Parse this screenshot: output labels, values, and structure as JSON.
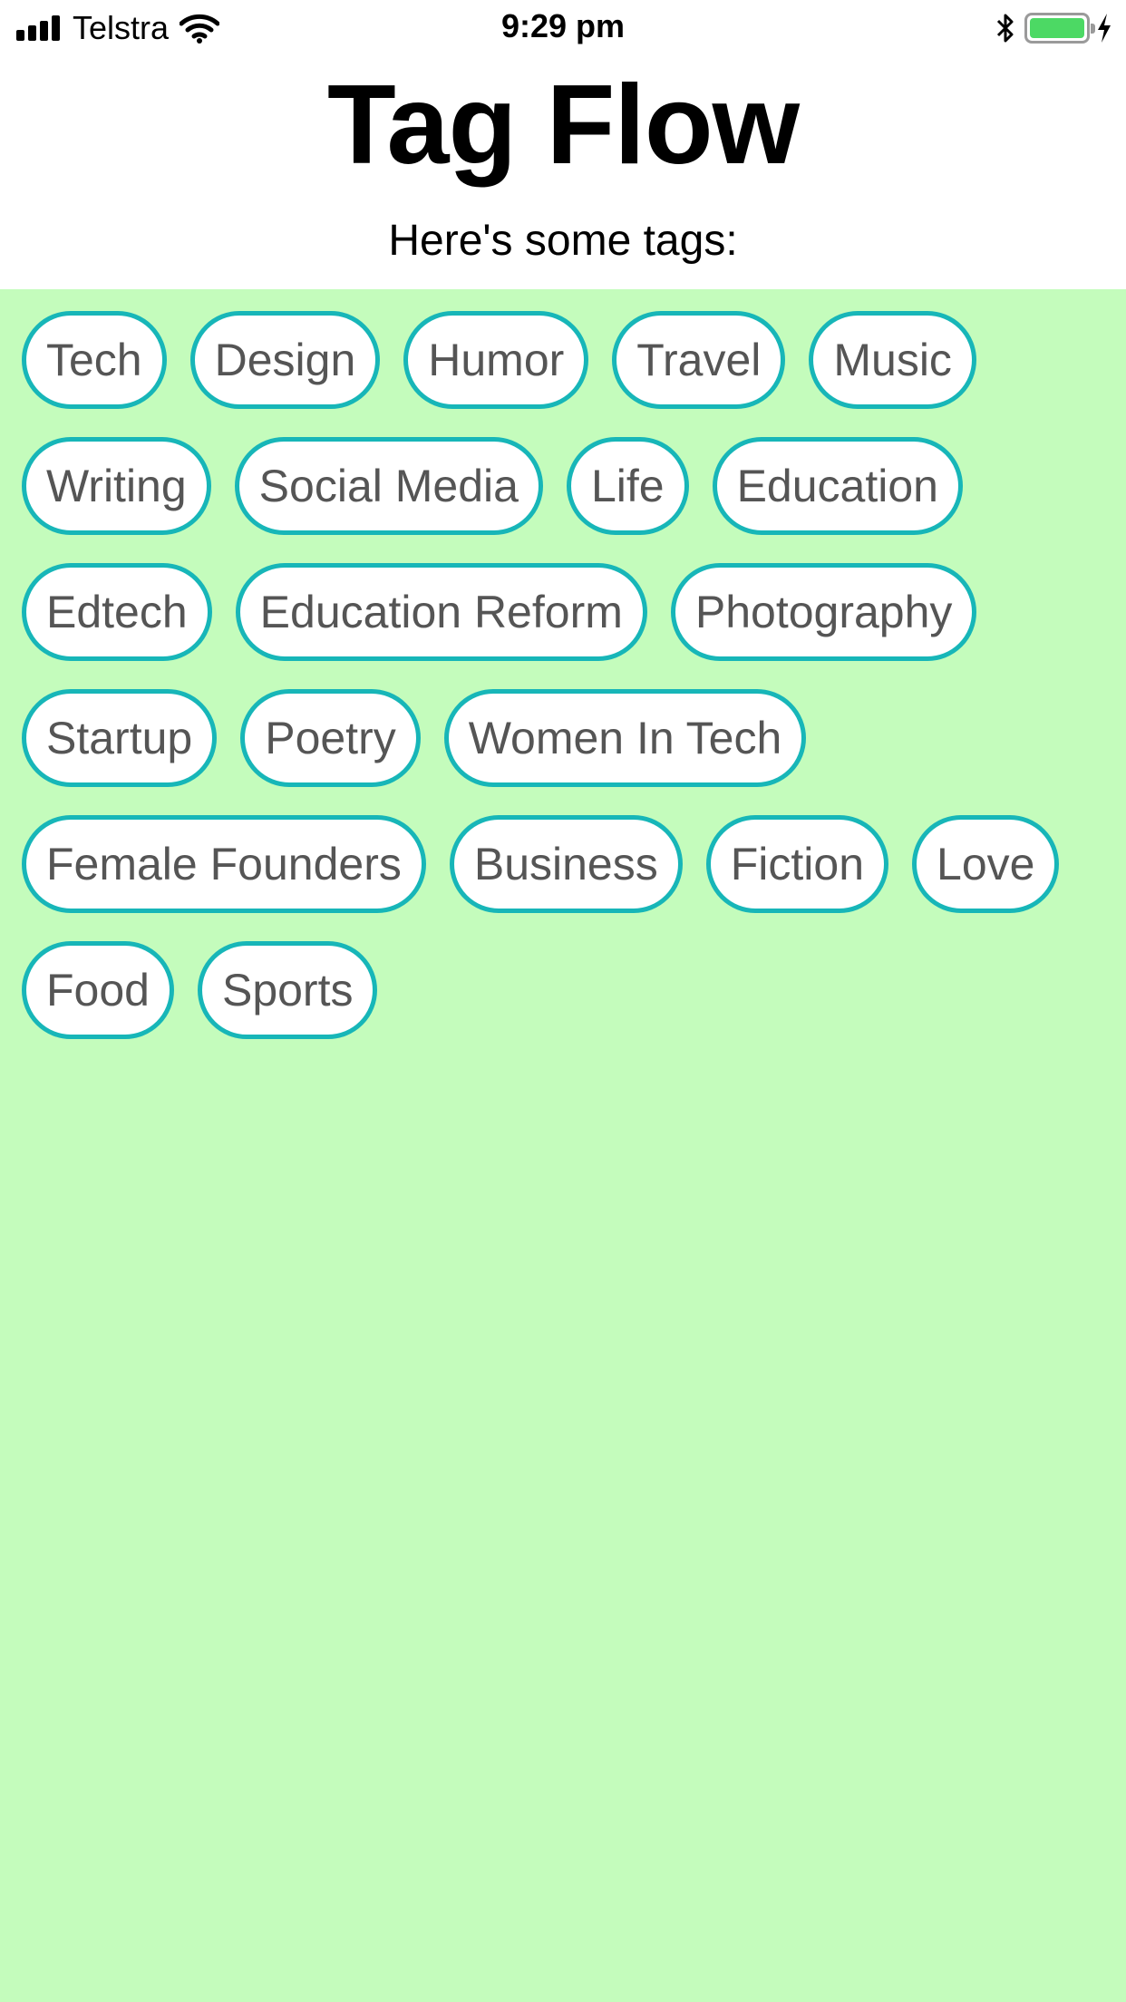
{
  "status_bar": {
    "carrier": "Telstra",
    "time": "9:29 pm",
    "icons": [
      "signal-icon",
      "wifi-icon",
      "bluetooth-icon",
      "battery-icon",
      "charging-icon"
    ],
    "battery_level": 1.0,
    "battery_color": "#4cd964"
  },
  "header": {
    "title": "Tag Flow",
    "subtitle": "Here's some tags:"
  },
  "colors": {
    "background": "#c4fcbc",
    "tag_border": "#17b6b8",
    "tag_text": "#555555"
  },
  "tags": [
    "Tech",
    "Design",
    "Humor",
    "Travel",
    "Music",
    "Writing",
    "Social Media",
    "Life",
    "Education",
    "Edtech",
    "Education Reform",
    "Photography",
    "Startup",
    "Poetry",
    "Women In Tech",
    "Female Founders",
    "Business",
    "Fiction",
    "Love",
    "Food",
    "Sports"
  ]
}
